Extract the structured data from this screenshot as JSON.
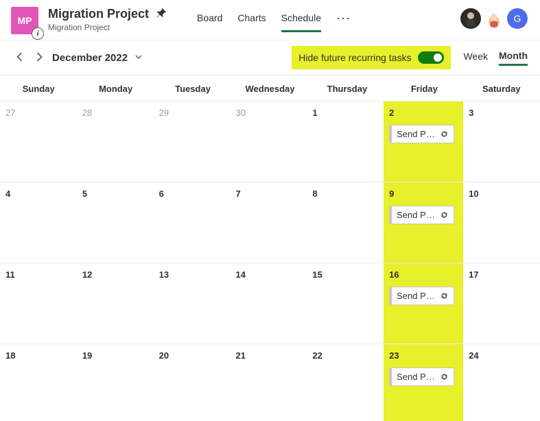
{
  "project": {
    "initials": "MP",
    "title": "Migration Project",
    "subtitle": "Migration Project"
  },
  "tabs": {
    "board": "Board",
    "charts": "Charts",
    "schedule": "Schedule"
  },
  "avatars": {
    "a3_initial": "G"
  },
  "toolbar": {
    "month_label": "December 2022",
    "toggle_label": "Hide future recurring tasks",
    "week": "Week",
    "month": "Month"
  },
  "dow": {
    "0": "Sunday",
    "1": "Monday",
    "2": "Tuesday",
    "3": "Wednesday",
    "4": "Thursday",
    "5": "Friday",
    "6": "Saturday"
  },
  "weeks": {
    "0": {
      "d0": "27",
      "d1": "28",
      "d2": "29",
      "d3": "30",
      "d4": "1",
      "d5": "2",
      "d6": "3"
    },
    "1": {
      "d0": "4",
      "d1": "5",
      "d2": "6",
      "d3": "7",
      "d4": "8",
      "d5": "9",
      "d6": "10"
    },
    "2": {
      "d0": "11",
      "d1": "12",
      "d2": "13",
      "d3": "14",
      "d4": "15",
      "d5": "16",
      "d6": "17"
    },
    "3": {
      "d0": "18",
      "d1": "19",
      "d2": "20",
      "d3": "21",
      "d4": "22",
      "d5": "23",
      "d6": "24"
    }
  },
  "task_label": "Send Proj…"
}
